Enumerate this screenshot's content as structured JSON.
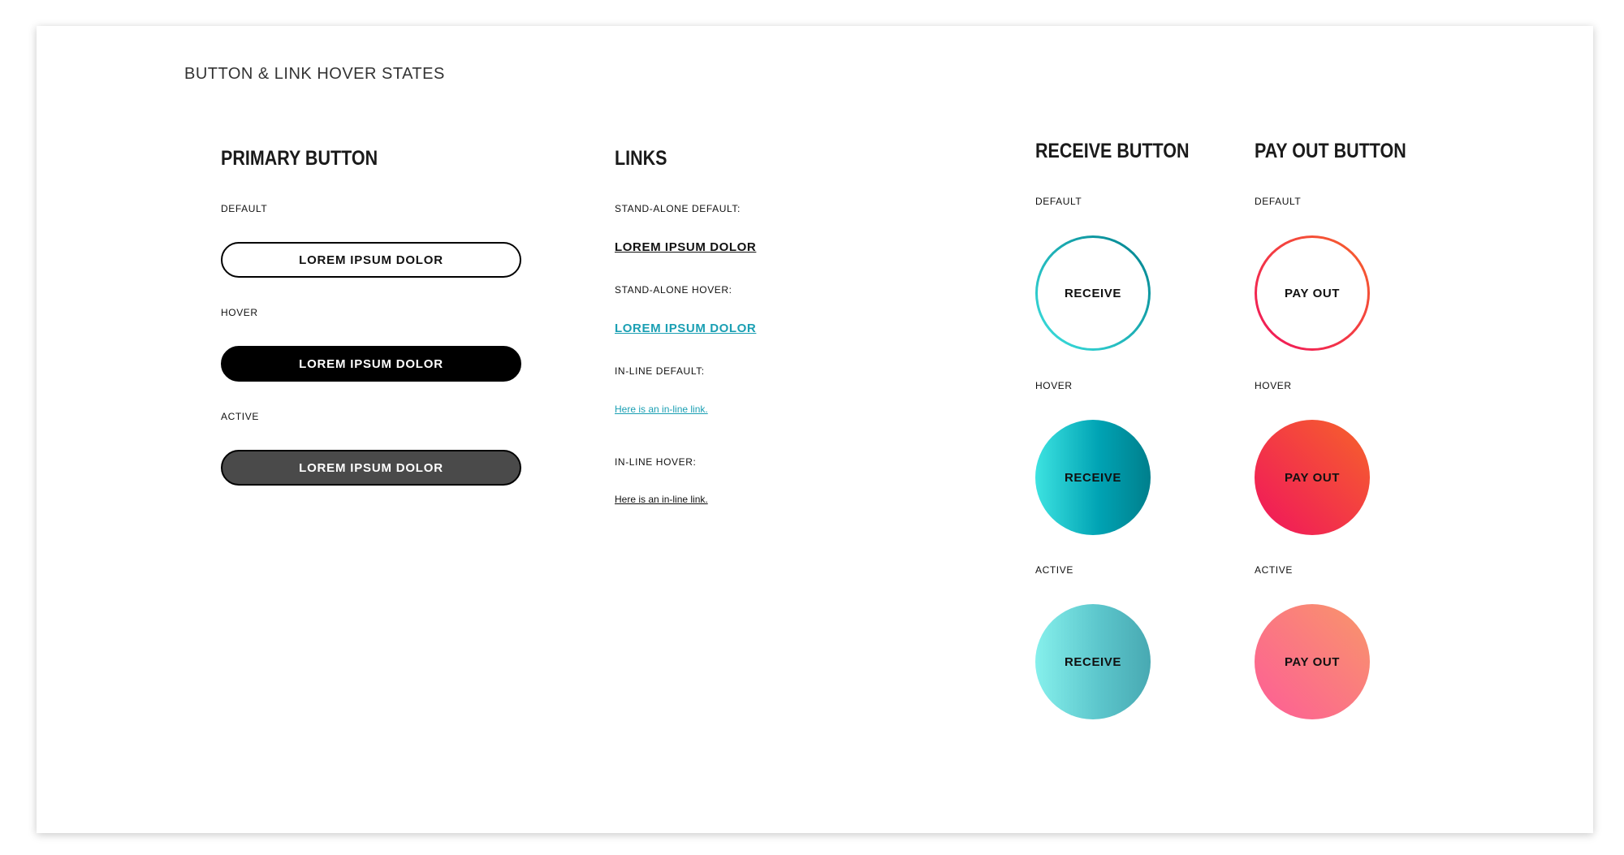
{
  "page": {
    "title": "BUTTON & LINK HOVER STATES"
  },
  "primary": {
    "title": "PRIMARY BUTTON",
    "default_label": "DEFAULT",
    "hover_label": "HOVER",
    "active_label": "ACTIVE",
    "button_text": "LOREM IPSUM DOLOR"
  },
  "links": {
    "title": "LINKS",
    "standalone_default_label": "STAND-ALONE DEFAULT:",
    "standalone_default_text": "LOREM IPSUM DOLOR",
    "standalone_hover_label": "STAND-ALONE HOVER:",
    "standalone_hover_text": "LOREM IPSUM DOLOR",
    "inline_default_label": "IN-LINE DEFAULT:",
    "inline_default_text": "Here is an in-line link.",
    "inline_hover_label": "IN-LINE HOVER:",
    "inline_hover_text": "Here is an in-line link."
  },
  "receive": {
    "title": "RECEIVE BUTTON",
    "default_label": "DEFAULT",
    "hover_label": "HOVER",
    "active_label": "ACTIVE",
    "button_text": "RECEIVE"
  },
  "payout": {
    "title": "PAY OUT BUTTON",
    "default_label": "DEFAULT",
    "hover_label": "HOVER",
    "active_label": "ACTIVE",
    "button_text": "PAY OUT"
  },
  "colors": {
    "link_teal": "#1a9fb3",
    "receive_light": "#3de3e1",
    "receive_dark": "#007f8c",
    "payout_pink": "#f0145d",
    "payout_orange": "#f6632a"
  }
}
